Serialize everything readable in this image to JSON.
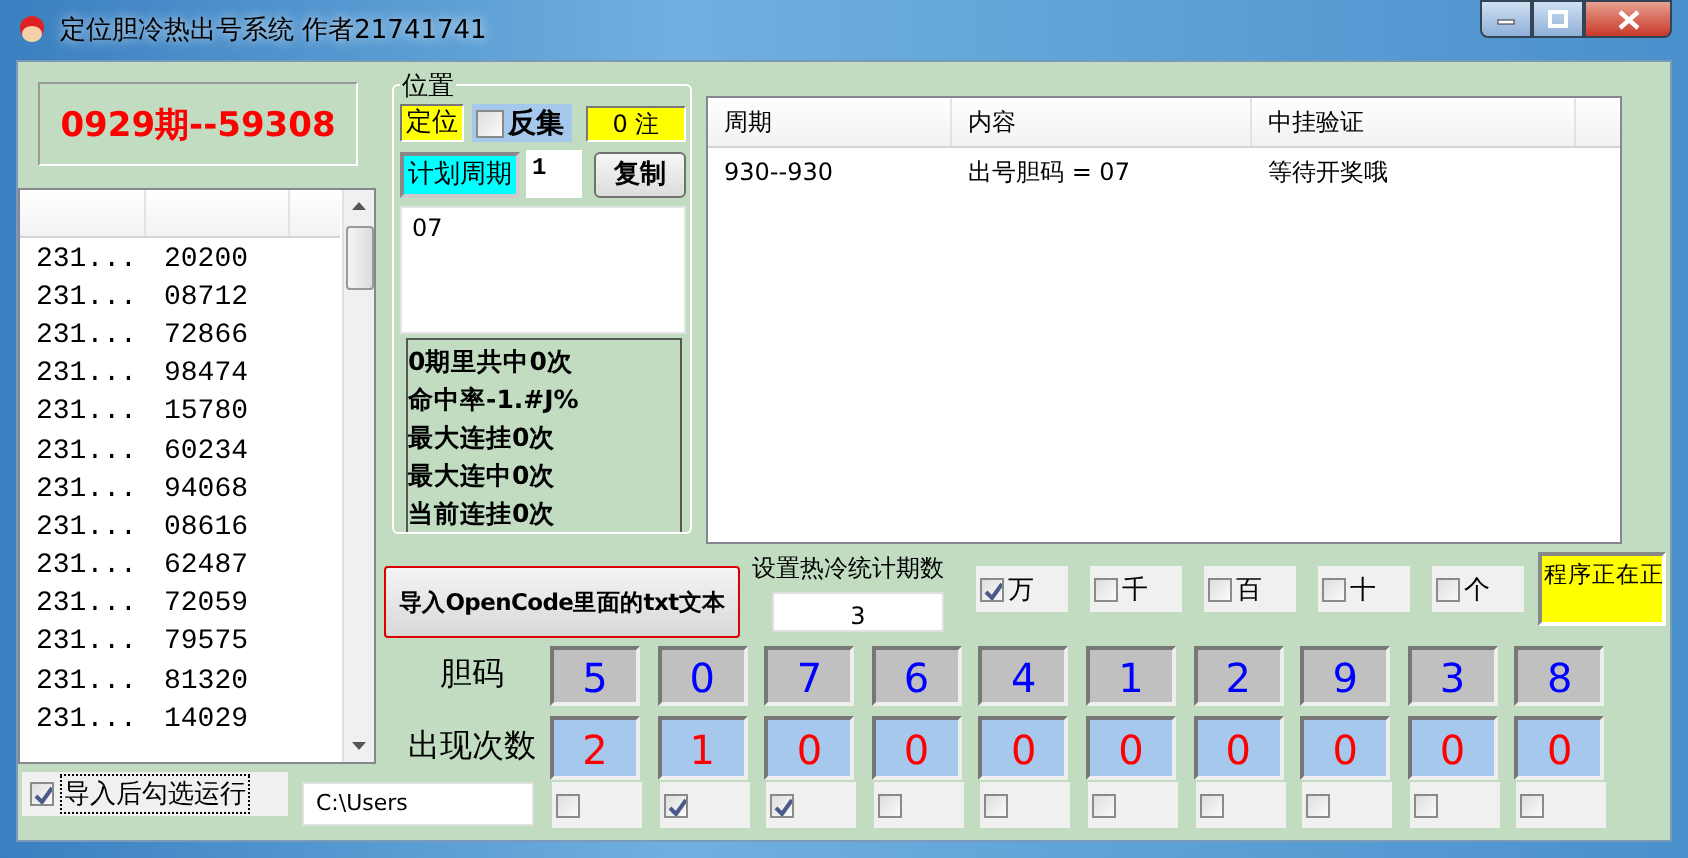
{
  "window": {
    "title": "定位胆冷热出号系统 作者21741741"
  },
  "result": "0929期--59308",
  "history": [
    {
      "period": "231...",
      "number": "20200"
    },
    {
      "period": "231...",
      "number": "08712"
    },
    {
      "period": "231...",
      "number": "72866"
    },
    {
      "period": "231...",
      "number": "98474"
    },
    {
      "period": "231...",
      "number": "15780"
    },
    {
      "period": "231...",
      "number": "60234"
    },
    {
      "period": "231...",
      "number": "94068"
    },
    {
      "period": "231...",
      "number": "08616"
    },
    {
      "period": "231...",
      "number": "62487"
    },
    {
      "period": "231...",
      "number": "72059"
    },
    {
      "period": "231...",
      "number": "79575"
    },
    {
      "period": "231...",
      "number": "81320"
    },
    {
      "period": "231...",
      "number": "14029"
    }
  ],
  "position_group": {
    "title": "位置",
    "mode_label": "定位",
    "reverse": {
      "label": "反集",
      "checked": false
    },
    "count": "0 注",
    "plan_label": "计划周期",
    "plan_value": "1",
    "copy_button": "复制",
    "output": "07",
    "stats": [
      "0期里共中0次",
      "命中率-1.#J%",
      "最大连挂0次",
      "最大连中0次",
      "当前连挂0次"
    ]
  },
  "table": {
    "columns": [
      "周期",
      "内容",
      "中挂验证"
    ],
    "rows": [
      [
        "930--930",
        "出号胆码 = 07",
        "等待开奖哦"
      ]
    ]
  },
  "import_button": "导入OpenCode里面的txt文本",
  "stat_periods": {
    "label": "设置热冷统计期数",
    "value": "3"
  },
  "digit_positions": [
    {
      "label": "万",
      "checked": true
    },
    {
      "label": "千",
      "checked": false
    },
    {
      "label": "百",
      "checked": false
    },
    {
      "label": "十",
      "checked": false
    },
    {
      "label": "个",
      "checked": false
    }
  ],
  "status": "程序正在正",
  "grid": {
    "code_label": "胆码",
    "count_label": "出现次数",
    "columns": [
      {
        "code": "5",
        "count": "2",
        "checked": false
      },
      {
        "code": "0",
        "count": "1",
        "checked": true
      },
      {
        "code": "7",
        "count": "0",
        "checked": true
      },
      {
        "code": "6",
        "count": "0",
        "checked": false
      },
      {
        "code": "4",
        "count": "0",
        "checked": false
      },
      {
        "code": "1",
        "count": "0",
        "checked": false
      },
      {
        "code": "2",
        "count": "0",
        "checked": false
      },
      {
        "code": "9",
        "count": "0",
        "checked": false
      },
      {
        "code": "3",
        "count": "0",
        "checked": false
      },
      {
        "code": "8",
        "count": "0",
        "checked": false
      }
    ]
  },
  "auto_run": {
    "label": "导入后勾选运行",
    "checked": true
  },
  "path": {
    "value": "C:\\Users"
  }
}
